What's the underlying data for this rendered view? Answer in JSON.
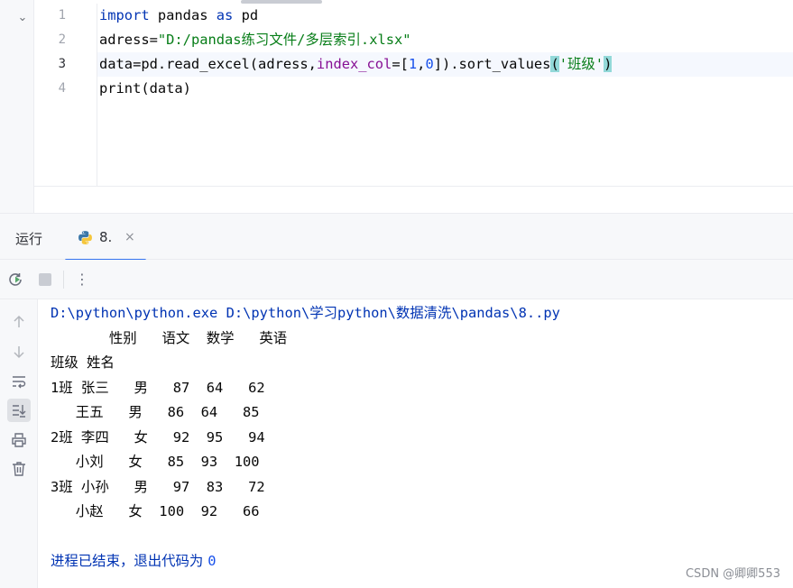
{
  "editor": {
    "lines": [
      {
        "number": "1",
        "tokens": [
          [
            "kw",
            "import"
          ],
          [
            "plain",
            " pandas "
          ],
          [
            "kw",
            "as"
          ],
          [
            "plain",
            " pd"
          ]
        ]
      },
      {
        "number": "2",
        "tokens": [
          [
            "plain",
            "adress="
          ],
          [
            "str",
            "\"D:/pandas练习文件/多层索引.xlsx\""
          ]
        ]
      },
      {
        "number": "3",
        "tokens": [
          [
            "plain",
            "data=pd.read_excel(adress,"
          ],
          [
            "param",
            "index_col"
          ],
          [
            "plain",
            "=["
          ],
          [
            "num",
            "1"
          ],
          [
            "plain",
            ","
          ],
          [
            "num",
            "0"
          ],
          [
            "plain",
            "]).sort_values"
          ],
          [
            "hl",
            "("
          ],
          [
            "str",
            "'班级'"
          ],
          [
            "hl",
            ")"
          ]
        ]
      },
      {
        "number": "4",
        "tokens": [
          [
            "plain",
            "print(data)"
          ]
        ]
      }
    ],
    "current_line": 3
  },
  "run_window": {
    "title": "运行",
    "tab_label": "8.",
    "tab_close": "×"
  },
  "toolbar": {
    "rerun_icon": "rerun-icon",
    "stop_icon": "stop-icon",
    "more_label": "⋮"
  },
  "side_toolbar": [
    "arrow-up-icon",
    "arrow-down-icon",
    "soft-wrap-icon",
    "scroll-to-end-icon",
    "print-icon",
    "trash-icon"
  ],
  "console": {
    "command": "D:\\python\\python.exe D:\\python\\学习python\\数据清洗\\pandas\\8..py",
    "output": [
      "       性别   语文  数学   英语",
      "班级 姓名                ",
      "1班 张三   男   87  64   62",
      "   王五   男   86  64   85",
      "2班 李四   女   92  95   94",
      "   小刘   女   85  93  100",
      "3班 小孙   男   97  83   72",
      "   小赵   女  100  92   66",
      ""
    ],
    "exit_text": "进程已结束，退出代码为 ",
    "exit_code": "0"
  },
  "watermark": "CSDN @卿卿553",
  "colors": {
    "keyword": "#0033b3",
    "string": "#067d17",
    "param": "#871094",
    "number": "#1750eb",
    "accent": "#3574f0"
  }
}
